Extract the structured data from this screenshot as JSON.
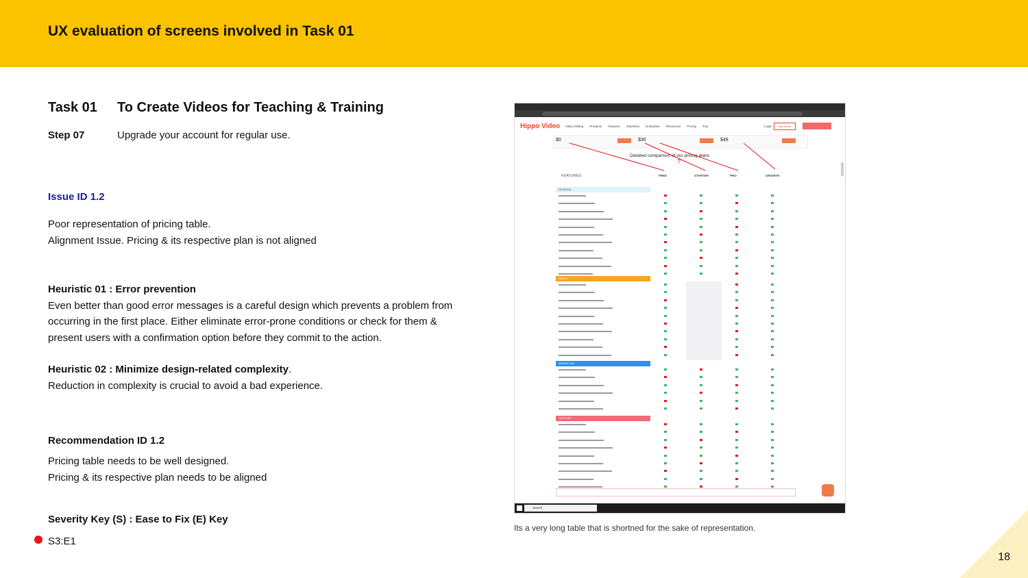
{
  "header": {
    "title": "UX evaluation of screens involved in Task 01"
  },
  "task": {
    "label": "Task 01",
    "title": "To Create Videos for Teaching & Training"
  },
  "step": {
    "label": "Step 07",
    "text": "Upgrade your account for regular use."
  },
  "issue": {
    "id": "Issue ID 1.2",
    "line1": "Poor representation of pricing table.",
    "line2": "Alignment Issue.  Pricing & its respective plan is not aligned"
  },
  "heuristic1": {
    "title": "Heuristic 01 : Error prevention",
    "text": "Even better than good error messages is a careful design which prevents a problem from occurring in the first place. Either eliminate error-prone conditions or check for them & present users with a confirmation option before they commit to the action."
  },
  "heuristic2": {
    "title": "Heuristic 02 : Minimize design-related complexity",
    "title_suffix": ".",
    "text": "Reduction in complexity is crucial to avoid a bad experience."
  },
  "recommendation": {
    "id": "Recommendation ID 1.2",
    "line1": "Pricing table needs to be well designed.",
    "line2": "Pricing & its respective plan needs to be aligned"
  },
  "severity": {
    "key_title": "Severity Key (S) : Ease to Fix (E) Key",
    "value": "S3:E1",
    "dot_color": "#E8141C"
  },
  "screenshot": {
    "caption": "Its a very long table that is shortned for the sake of representation.",
    "logo": "Hippo Video",
    "nav": [
      "Video Selling",
      "Products",
      "Features",
      "Industries",
      "Enterprise",
      "Resources",
      "Pricing",
      "Tour"
    ],
    "login": "Login",
    "cta": "Get Demo",
    "prices": [
      "$0",
      "$30",
      "$48"
    ],
    "table_heading": "Detailed comparison of our pricing plans",
    "question_mark": "?",
    "features_label": "FEATURES",
    "plans": [
      "FREE",
      "STARTER",
      "PRO",
      "GROWTH"
    ],
    "sections": [
      {
        "name": "GENERAL",
        "color": "#DDF3F7"
      },
      {
        "name": "SALES",
        "color": "#F5A623"
      },
      {
        "name": "MARKETING",
        "color": "#2F8EF0"
      },
      {
        "name": "SUPPORT",
        "color": "#F06A7A"
      }
    ],
    "taskbar_search": "Search"
  },
  "page_number": "18"
}
